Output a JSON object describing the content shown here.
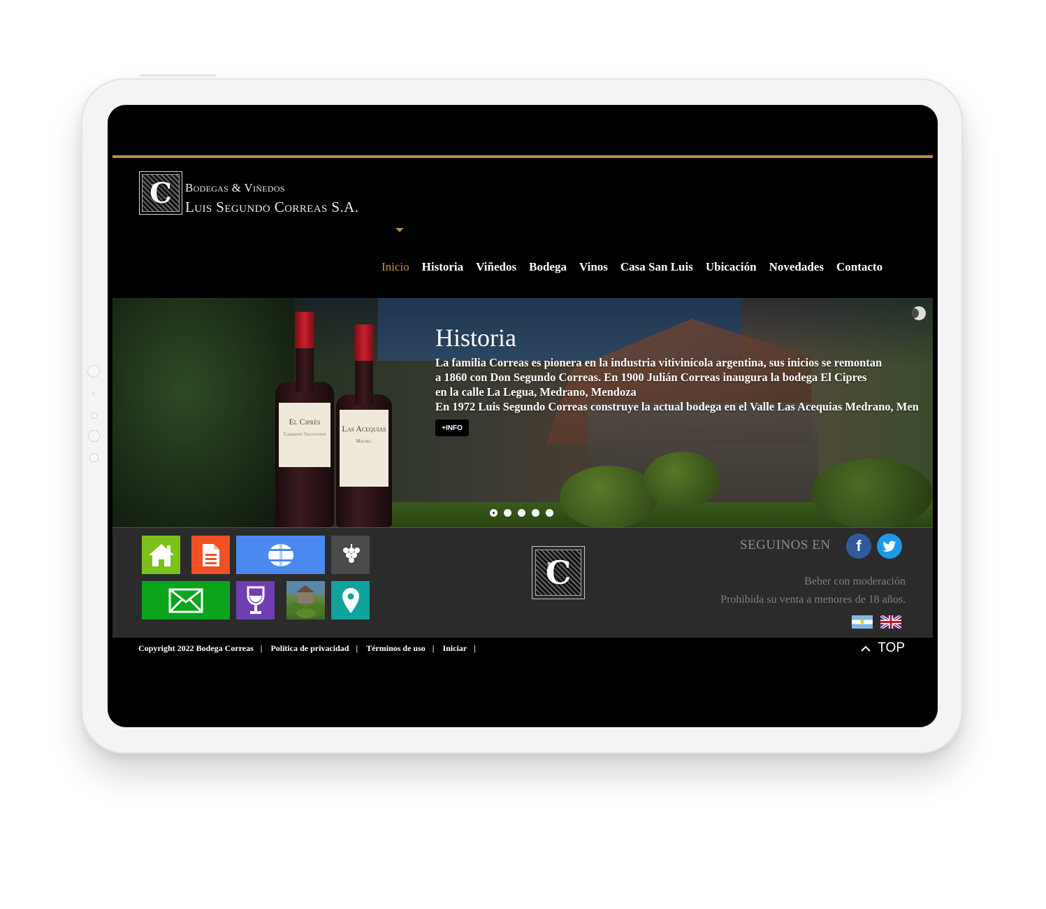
{
  "brand": {
    "line1": "Bodegas & Viñedos",
    "line2": "Luis Segundo Correas S.A.",
    "monogram": "C"
  },
  "nav": {
    "items": [
      {
        "label": "Inicio",
        "active": true
      },
      {
        "label": "Historia"
      },
      {
        "label": "Viñedos"
      },
      {
        "label": "Bodega"
      },
      {
        "label": "Vinos"
      },
      {
        "label": "Casa San Luis"
      },
      {
        "label": "Ubicación"
      },
      {
        "label": "Novedades"
      },
      {
        "label": "Contacto"
      }
    ]
  },
  "hero": {
    "title": "Historia",
    "lines": [
      "La familia Correas es pionera en la industria vitivinícola argentina, sus inicios se remontan",
      "a 1860 con Don Segundo Correas. En 1900 Julián Correas inaugura la bodega El Cipres",
      "en la calle La Legua, Medrano, Mendoza",
      "En 1972 Luis Segundo Correas construye la actual bodega en el Valle Las Acequias Medrano, Men"
    ],
    "button_label": "+INFO",
    "bottle1": {
      "label": "El Ciprés",
      "sub": "Cabernet Sauvignon"
    },
    "bottle2": {
      "label": "Las Acequias",
      "sub": "Malbec"
    },
    "slides_count": 5,
    "active_slide": 1
  },
  "footer": {
    "tiles": [
      {
        "name": "home",
        "color": "#7cc11b",
        "icon": "house-icon"
      },
      {
        "name": "document",
        "color": "#f05022",
        "icon": "document-icon"
      },
      {
        "name": "barrel",
        "color": "#4a8af0",
        "icon": "barrel-icon"
      },
      {
        "name": "grapes",
        "color": "#4a4a4a",
        "icon": "grapes-icon"
      },
      {
        "name": "mail",
        "color": "#0aa51b",
        "icon": "envelope-icon"
      },
      {
        "name": "wine",
        "color": "#6f3fb0",
        "icon": "wine-glass-icon"
      },
      {
        "name": "photo",
        "color": "#3a6a8a",
        "icon": "photo-icon"
      },
      {
        "name": "location",
        "color": "#0fa39b",
        "icon": "location-pin-icon"
      }
    ],
    "follow_label": "SEGUINOS EN",
    "facebook": "f",
    "twitter": "t",
    "warning1": "Beber con moderación",
    "warning2": "Prohibida su venta a menores de 18 años."
  },
  "bottom": {
    "copyright": "Copyright 2022 Bodega Correas",
    "links": [
      "Política de privacidad",
      "Términos de uso",
      "Iniciar"
    ],
    "top_label": "TOP"
  }
}
